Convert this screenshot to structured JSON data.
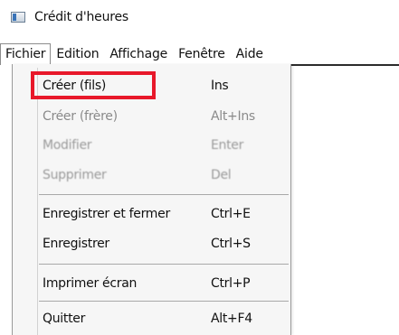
{
  "window": {
    "title": "Crédit d'heures"
  },
  "menubar": {
    "items": [
      "Fichier",
      "Edition",
      "Affichage",
      "Fenêtre",
      "Aide"
    ]
  },
  "fichier_menu": {
    "items": [
      {
        "label": "Créer (fils)",
        "shortcut": "Ins"
      },
      {
        "label": "Créer (frère)",
        "shortcut": "Alt+Ins"
      },
      {
        "label": "Modifier",
        "shortcut": "Enter"
      },
      {
        "label": "Supprimer",
        "shortcut": "Del"
      },
      {
        "label": "Enregistrer et fermer",
        "shortcut": "Ctrl+E"
      },
      {
        "label": "Enregistrer",
        "shortcut": "Ctrl+S"
      },
      {
        "label": "Imprimer écran",
        "shortcut": "Ctrl+P"
      },
      {
        "label": "Quitter",
        "shortcut": "Alt+F4"
      }
    ]
  },
  "colors": {
    "highlight_border": "#e8182a",
    "menu_bg": "#f6f6f6"
  }
}
